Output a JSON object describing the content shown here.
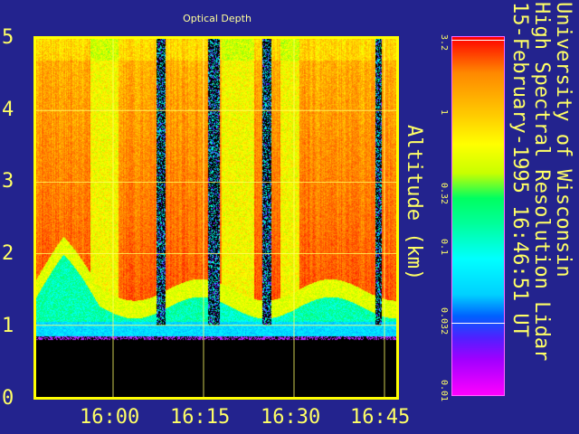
{
  "chart_data": {
    "type": "heatmap",
    "title": "Optical Depth",
    "ylabel": "Altitude (km)",
    "ylim": [
      0,
      5
    ],
    "yticks": [
      "0",
      "1",
      "2",
      "3",
      "4",
      "5"
    ],
    "xticks": [
      "16:00",
      "16:15",
      "16:30",
      "16:45"
    ],
    "colorbar": {
      "ticks": [
        "3.2",
        "1",
        "0.32",
        "0.1",
        "0.032",
        "0.01"
      ],
      "scale": "log"
    },
    "features": {
      "ground_black_below_km": 0.85,
      "boundary_layer_top_km": 1.3,
      "aerosol_band_km": [
        1.0,
        1.3
      ]
    },
    "colors": {
      "background": "#23238e",
      "frame": "#ffff00",
      "text": "#ffff66"
    }
  },
  "header": {
    "info_line1": "University of Wisconsin",
    "info_line2": "High Spectral Resolution Lidar",
    "info_line3": "15-February-1995 16:46:51 UT"
  }
}
